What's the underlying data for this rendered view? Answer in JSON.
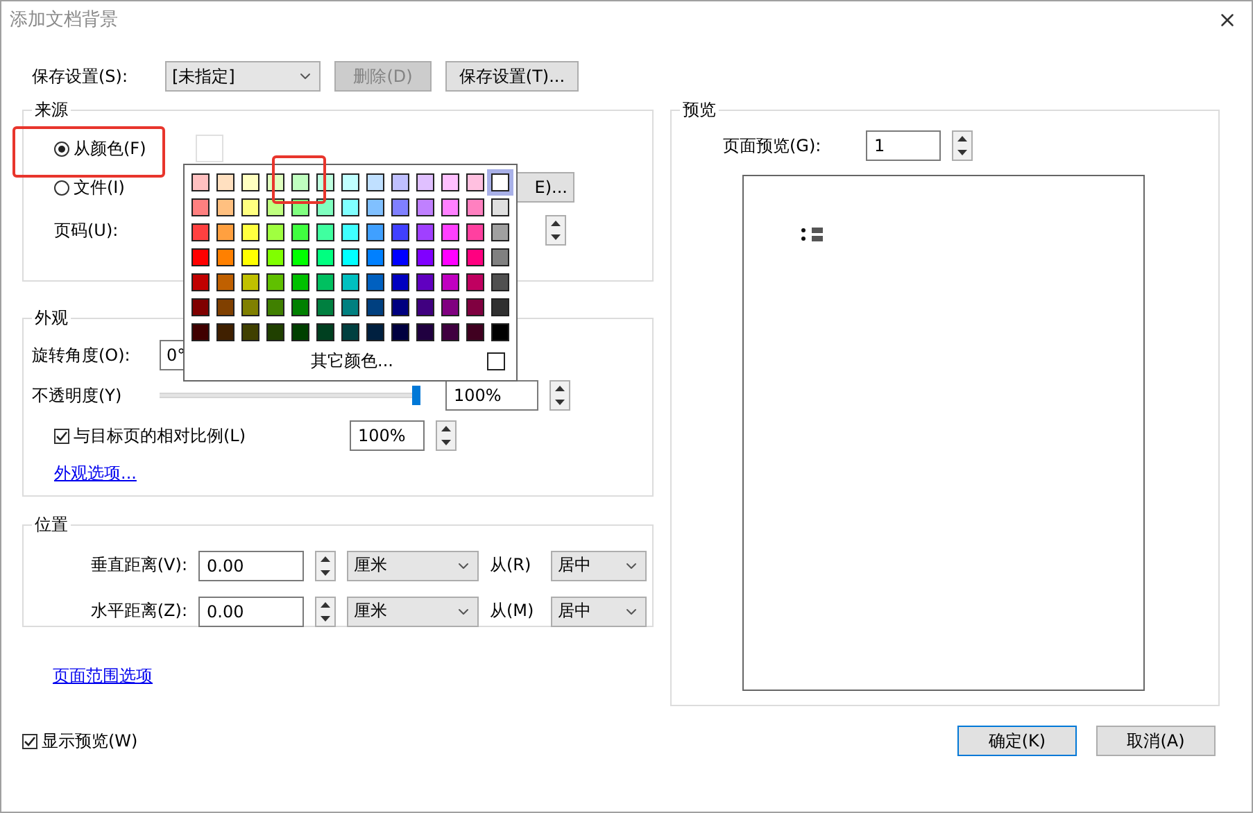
{
  "window": {
    "title": "添加文档背景"
  },
  "saved_settings": {
    "label": "保存设置(S):",
    "value": "[未指定]",
    "delete_button": {
      "label": "删除(D)",
      "disabled": true
    },
    "save_button": {
      "label": "保存设置(T)...",
      "disabled": false
    }
  },
  "source": {
    "title": "来源",
    "color_preview": {
      "color": "#ffffff"
    },
    "options": [
      {
        "label": "从颜色(F)",
        "selected": true
      },
      {
        "label": "文件(I)",
        "selected": false
      }
    ],
    "browse_button": "E)...",
    "page_label": "页码(U):"
  },
  "color_popup": {
    "swatch_rows": [
      {
        "swatches": [
          {
            "color": "#ffc0c0",
            "selected": false
          },
          {
            "color": "#ffe0c0",
            "selected": false
          },
          {
            "color": "#ffffc0",
            "selected": false
          },
          {
            "color": "#e0ffc0",
            "selected": false
          },
          {
            "color": "#c0ffc0",
            "selected": false
          },
          {
            "color": "#c0ffe0",
            "selected": false
          },
          {
            "color": "#c0ffff",
            "selected": false
          },
          {
            "color": "#c0e0ff",
            "selected": false
          },
          {
            "color": "#c0c0ff",
            "selected": false
          },
          {
            "color": "#e0c0ff",
            "selected": false
          },
          {
            "color": "#ffc0ff",
            "selected": false
          },
          {
            "color": "#ffc0e0",
            "selected": false
          },
          {
            "color": "#ffffff",
            "selected": true
          }
        ]
      },
      {
        "swatches": [
          {
            "color": "#ff8080",
            "selected": false
          },
          {
            "color": "#ffc080",
            "selected": false
          },
          {
            "color": "#ffff80",
            "selected": false
          },
          {
            "color": "#c0ff80",
            "selected": false
          },
          {
            "color": "#80ff80",
            "selected": false
          },
          {
            "color": "#80ffc0",
            "selected": false
          },
          {
            "color": "#80ffff",
            "selected": false
          },
          {
            "color": "#80c0ff",
            "selected": false
          },
          {
            "color": "#8080ff",
            "selected": false
          },
          {
            "color": "#c080ff",
            "selected": false
          },
          {
            "color": "#ff80ff",
            "selected": false
          },
          {
            "color": "#ff80c0",
            "selected": false
          },
          {
            "color": "#e0e0e0",
            "selected": false
          }
        ]
      },
      {
        "swatches": [
          {
            "color": "#ff4040",
            "selected": false
          },
          {
            "color": "#ffa040",
            "selected": false
          },
          {
            "color": "#ffff40",
            "selected": false
          },
          {
            "color": "#a0ff40",
            "selected": false
          },
          {
            "color": "#40ff40",
            "selected": false
          },
          {
            "color": "#40ffa0",
            "selected": false
          },
          {
            "color": "#40ffff",
            "selected": false
          },
          {
            "color": "#40a0ff",
            "selected": false
          },
          {
            "color": "#4040ff",
            "selected": false
          },
          {
            "color": "#a040ff",
            "selected": false
          },
          {
            "color": "#ff40ff",
            "selected": false
          },
          {
            "color": "#ff40a0",
            "selected": false
          },
          {
            "color": "#a0a0a0",
            "selected": false
          }
        ]
      },
      {
        "swatches": [
          {
            "color": "#ff0000",
            "selected": false
          },
          {
            "color": "#ff8000",
            "selected": false
          },
          {
            "color": "#ffff00",
            "selected": false
          },
          {
            "color": "#80ff00",
            "selected": false
          },
          {
            "color": "#00ff00",
            "selected": false
          },
          {
            "color": "#00ff80",
            "selected": false
          },
          {
            "color": "#00ffff",
            "selected": false
          },
          {
            "color": "#0080ff",
            "selected": false
          },
          {
            "color": "#0000ff",
            "selected": false
          },
          {
            "color": "#8000ff",
            "selected": false
          },
          {
            "color": "#ff00ff",
            "selected": false
          },
          {
            "color": "#ff0080",
            "selected": false
          },
          {
            "color": "#808080",
            "selected": false
          }
        ]
      },
      {
        "swatches": [
          {
            "color": "#c00000",
            "selected": false
          },
          {
            "color": "#c06000",
            "selected": false
          },
          {
            "color": "#c0c000",
            "selected": false
          },
          {
            "color": "#60c000",
            "selected": false
          },
          {
            "color": "#00c000",
            "selected": false
          },
          {
            "color": "#00c060",
            "selected": false
          },
          {
            "color": "#00c0c0",
            "selected": false
          },
          {
            "color": "#0060c0",
            "selected": false
          },
          {
            "color": "#0000c0",
            "selected": false
          },
          {
            "color": "#6000c0",
            "selected": false
          },
          {
            "color": "#c000c0",
            "selected": false
          },
          {
            "color": "#c00060",
            "selected": false
          },
          {
            "color": "#505050",
            "selected": false
          }
        ]
      },
      {
        "swatches": [
          {
            "color": "#800000",
            "selected": false
          },
          {
            "color": "#804000",
            "selected": false
          },
          {
            "color": "#808000",
            "selected": false
          },
          {
            "color": "#408000",
            "selected": false
          },
          {
            "color": "#008000",
            "selected": false
          },
          {
            "color": "#008040",
            "selected": false
          },
          {
            "color": "#008080",
            "selected": false
          },
          {
            "color": "#004080",
            "selected": false
          },
          {
            "color": "#000080",
            "selected": false
          },
          {
            "color": "#400080",
            "selected": false
          },
          {
            "color": "#800080",
            "selected": false
          },
          {
            "color": "#800040",
            "selected": false
          },
          {
            "color": "#303030",
            "selected": false
          }
        ]
      },
      {
        "swatches": [
          {
            "color": "#400000",
            "selected": false
          },
          {
            "color": "#402000",
            "selected": false
          },
          {
            "color": "#404000",
            "selected": false
          },
          {
            "color": "#204000",
            "selected": false
          },
          {
            "color": "#004000",
            "selected": false
          },
          {
            "color": "#004020",
            "selected": false
          },
          {
            "color": "#004040",
            "selected": false
          },
          {
            "color": "#002040",
            "selected": false
          },
          {
            "color": "#000040",
            "selected": false
          },
          {
            "color": "#200040",
            "selected": false
          },
          {
            "color": "#400040",
            "selected": false
          },
          {
            "color": "#400020",
            "selected": false
          },
          {
            "color": "#000000",
            "selected": false
          }
        ]
      }
    ],
    "more_colors": "其它颜色..."
  },
  "appearance": {
    "title": "外观",
    "rotation_label": "旋转角度(O):",
    "rotation_value": "0°",
    "opacity_label": "不透明度(Y)",
    "opacity": {
      "level": 1
    },
    "opacity_value": "100%",
    "scale": {
      "label": "与目标页的相对比例(L)",
      "checked": true,
      "value": "100%"
    },
    "options_link": "外观选项..."
  },
  "position": {
    "title": "位置",
    "rows": [
      {
        "label": "垂直距离(V):",
        "value": "0.00",
        "unit": "厘米",
        "from_label": "从(R)",
        "from_value": "居中"
      },
      {
        "label": "水平距离(Z):",
        "value": "0.00",
        "unit": "厘米",
        "from_label": "从(M)",
        "from_value": "居中"
      }
    ]
  },
  "page_range_link": "页面范围选项",
  "show_preview": {
    "label": "显示预览(W)",
    "checked": true
  },
  "preview": {
    "title": "预览",
    "page_label": "页面预览(G):",
    "page_value": "1"
  },
  "buttons": [
    {
      "label": "确定(K)",
      "default": true
    },
    {
      "label": "取消(A)",
      "default": false
    }
  ],
  "annotations": [
    {
      "kind": "red_box"
    },
    {
      "kind": "red_box"
    }
  ]
}
